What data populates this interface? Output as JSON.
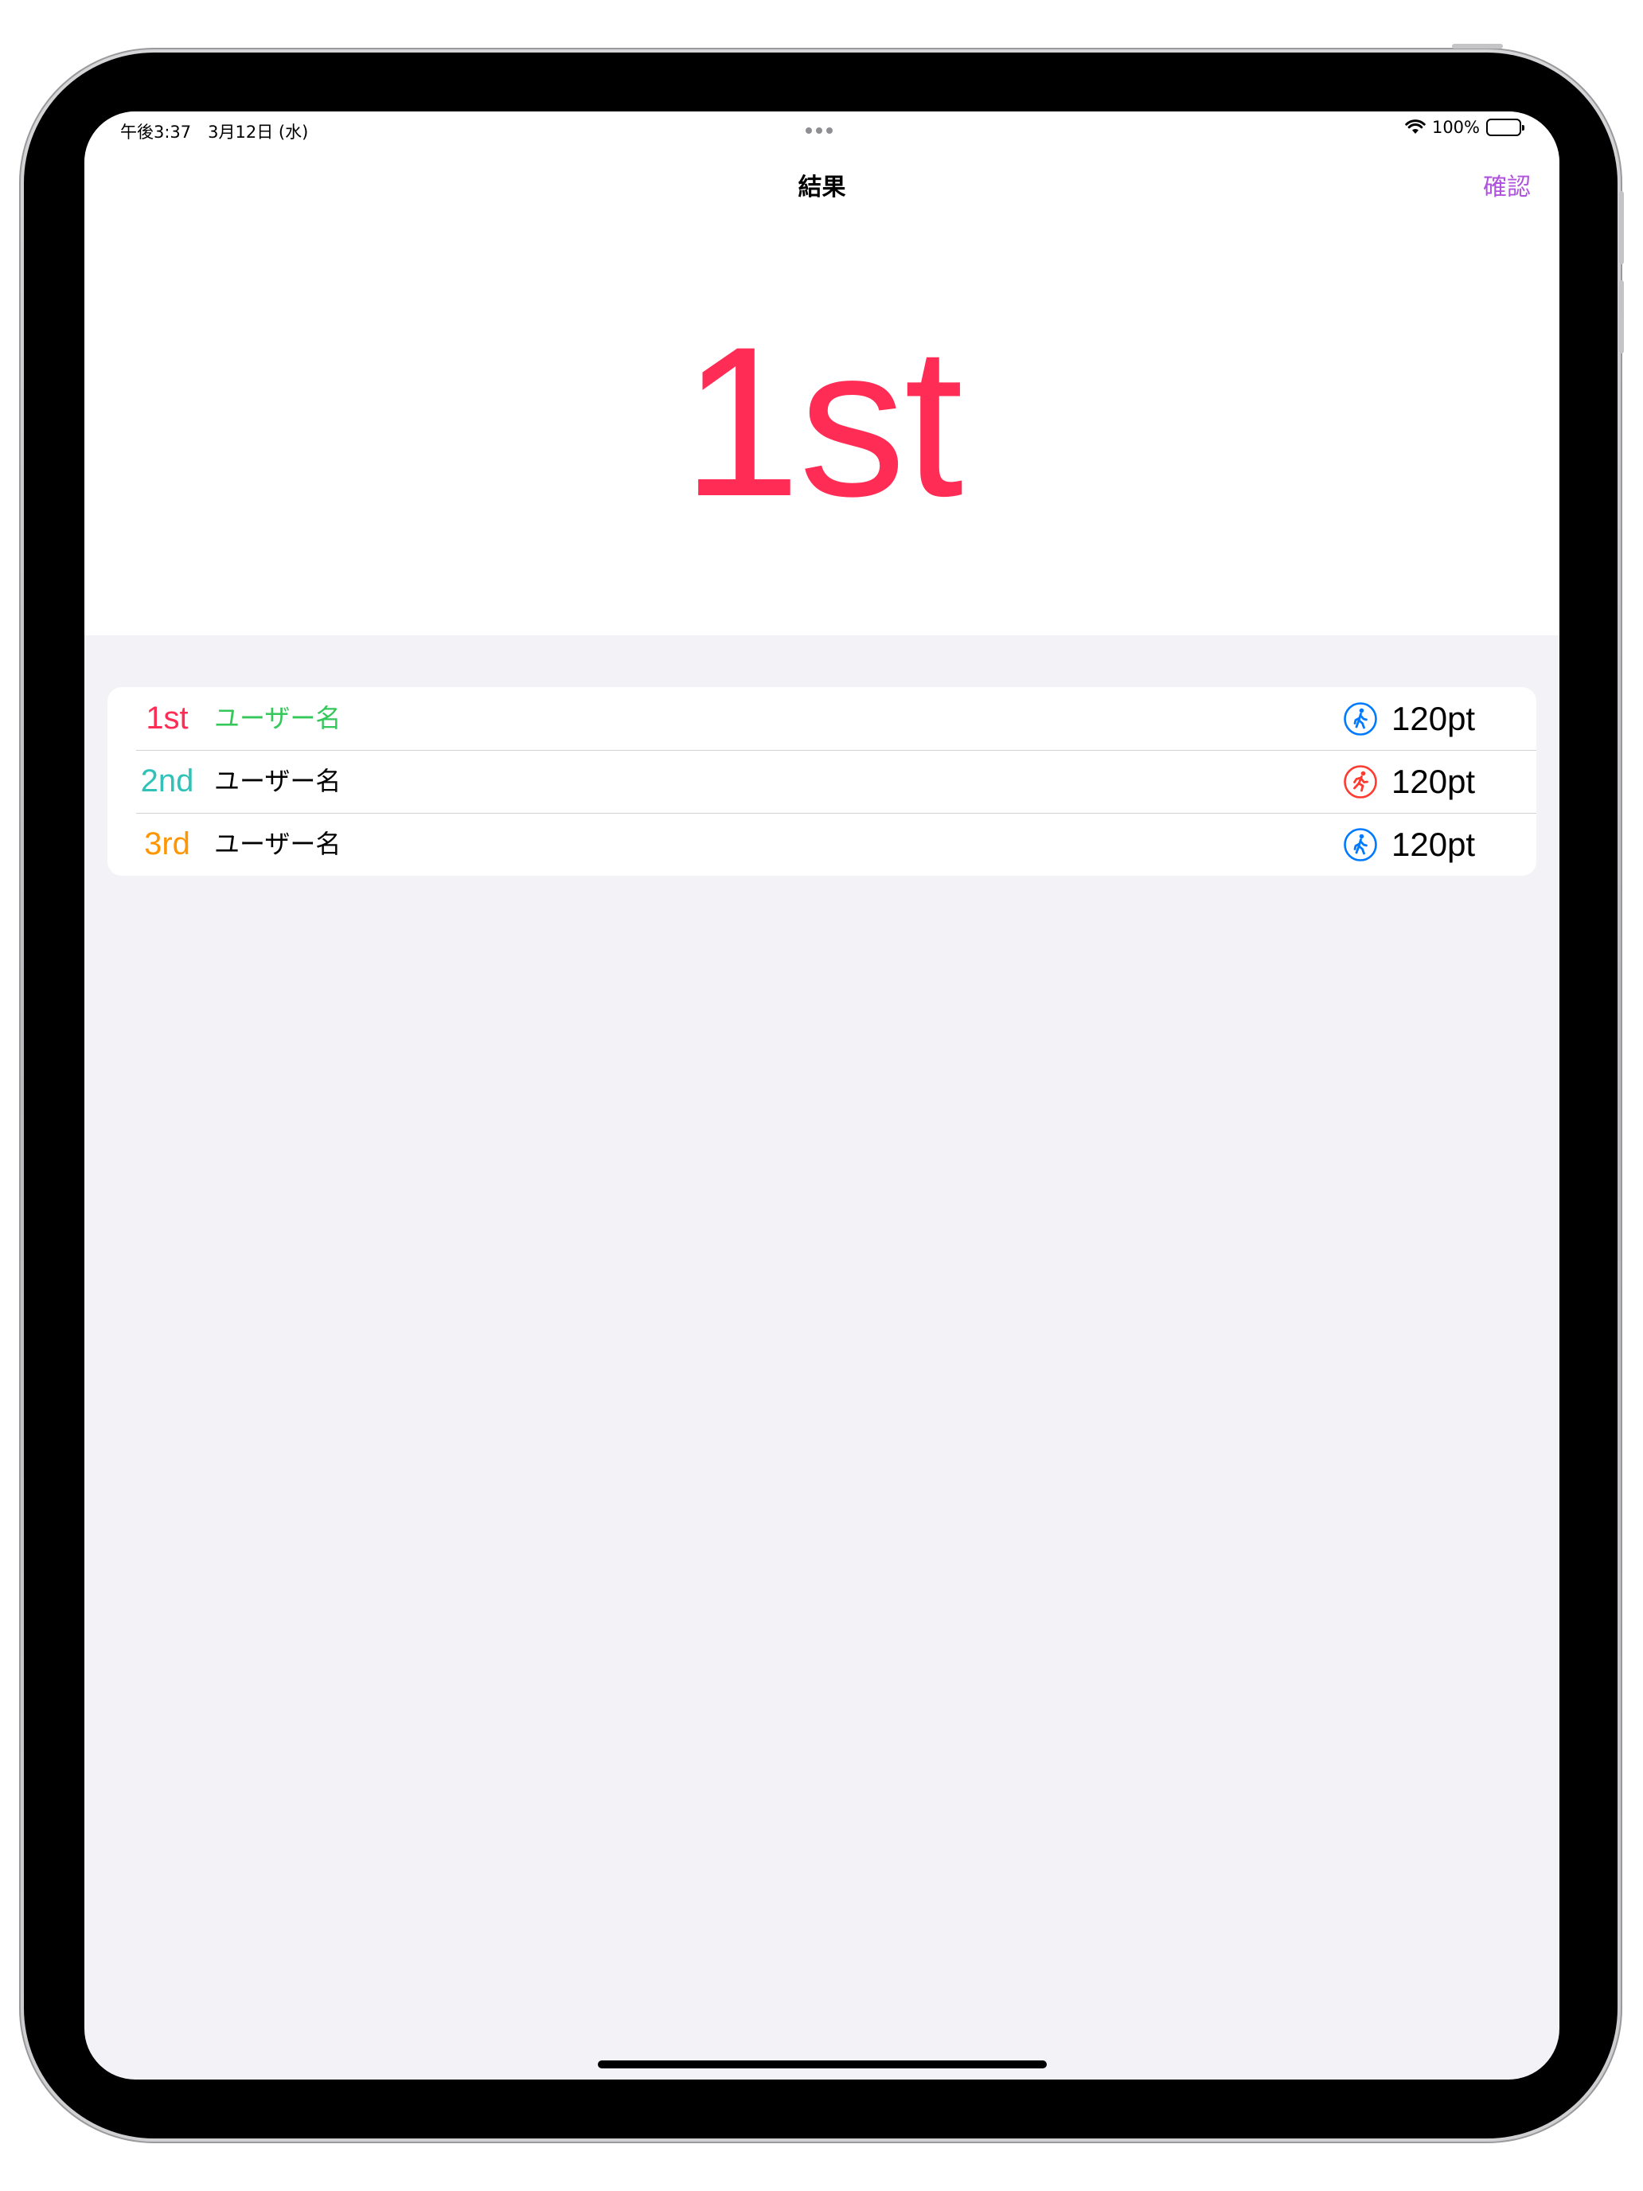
{
  "status_bar": {
    "time": "午後3:37　3月12日 (水)",
    "battery": "100%"
  },
  "nav": {
    "title": "結果",
    "confirm_label": "確認"
  },
  "hero": {
    "rank": "1st",
    "color": "#ff2d55"
  },
  "results": [
    {
      "rank": "1st",
      "rank_color": "#ff2d55",
      "name": "ユーザー名",
      "name_color": "#34c759",
      "icon": "figure-walk-circle-icon",
      "icon_color": "#007aff",
      "score": "120pt"
    },
    {
      "rank": "2nd",
      "rank_color": "#30c2b8",
      "name": "ユーザー名",
      "name_color": "#000000",
      "icon": "figure-run-circle-icon",
      "icon_color": "#ff3b30",
      "score": "120pt"
    },
    {
      "rank": "3rd",
      "rank_color": "#ff9500",
      "name": "ユーザー名",
      "name_color": "#000000",
      "icon": "figure-walk-circle-icon",
      "icon_color": "#007aff",
      "score": "120pt"
    }
  ],
  "colors": {
    "accent_purple": "#af52de",
    "background_grouped": "#f2f2f7",
    "surface": "#ffffff"
  }
}
